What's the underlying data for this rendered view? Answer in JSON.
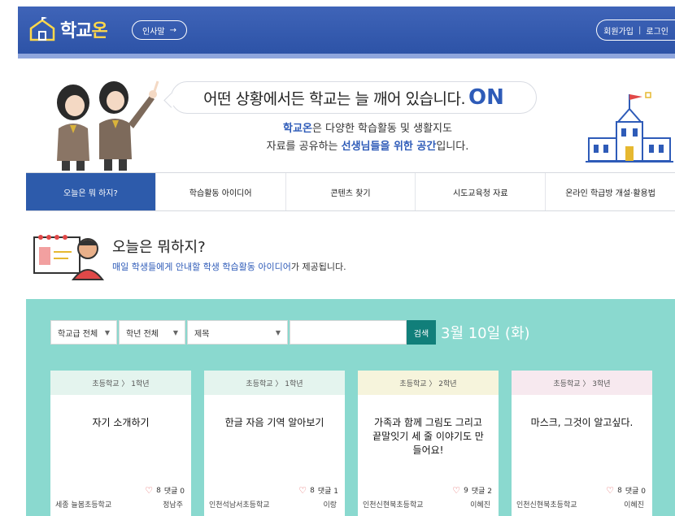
{
  "header": {
    "logo_text_a": "학교",
    "logo_text_b": "온",
    "greeting_button": "인사말",
    "greeting_arrow": "→",
    "signup": "회원가입",
    "separator": "|",
    "login": "로그인"
  },
  "hero": {
    "bubble_text": "어떤 상황에서든 학교는 늘 깨어 있습니다.",
    "bubble_on": "ON",
    "desc1_brand": "학교온",
    "desc1_rest": "은 다양한 학습활동 및 생활지도",
    "desc2_start": "자료를 공유하는 ",
    "desc2_blue": "선생님들을 위한 공간",
    "desc2_end": "입니다."
  },
  "tabs": [
    {
      "label": "오늘은 뭐 하지?"
    },
    {
      "label": "학습활동 아이디어"
    },
    {
      "label": "콘텐츠 찾기"
    },
    {
      "label": "시도교육청 자료"
    },
    {
      "label": "온라인 학급방 개설·활용법"
    }
  ],
  "section": {
    "title": "오늘은 뭐하지?",
    "subtitle_blue": "매일 학생들에게 안내할 학생 학습활동 아이디어",
    "subtitle_rest": "가 제공됩니다."
  },
  "filters": {
    "school_level": "학교급 전체",
    "grade": "학년 전체",
    "field": "제목",
    "caret": "▼",
    "search_button": "검색",
    "date": "3월 10일 (화)"
  },
  "cards": [
    {
      "category": "초등학교 〉 1학년",
      "title": "자기 소개하기",
      "likes": "8",
      "comments": "댓글 0",
      "school": "세종 늘봄초등학교",
      "author": "정남주",
      "head_color": "#e4f4ee"
    },
    {
      "category": "초등학교 〉 1학년",
      "title": "한글 자음 기역 알아보기",
      "likes": "8",
      "comments": "댓글 1",
      "school": "인천석남서초등학교",
      "author": "이랑",
      "head_color": "#e4f4ee"
    },
    {
      "category": "초등학교 〉 2학년",
      "title": "가족과 함께 그림도 그리고 끝말잇기 세 줄 이야기도 만들어요!",
      "likes": "9",
      "comments": "댓글 2",
      "school": "인천신현북초등학교",
      "author": "이혜진",
      "head_color": "#f6f4dc"
    },
    {
      "category": "초등학교 〉 3학년",
      "title": "마스크, 그것이 알고싶다.",
      "likes": "8",
      "comments": "댓글 0",
      "school": "인천신현북초등학교",
      "author": "이혜진",
      "head_color": "#f7e9ef"
    }
  ],
  "colors": {
    "header_blue": "#2d53a7",
    "accent_yellow": "#ffd84a",
    "teal": "#8ad9cf",
    "search_btn": "#117f7a"
  }
}
